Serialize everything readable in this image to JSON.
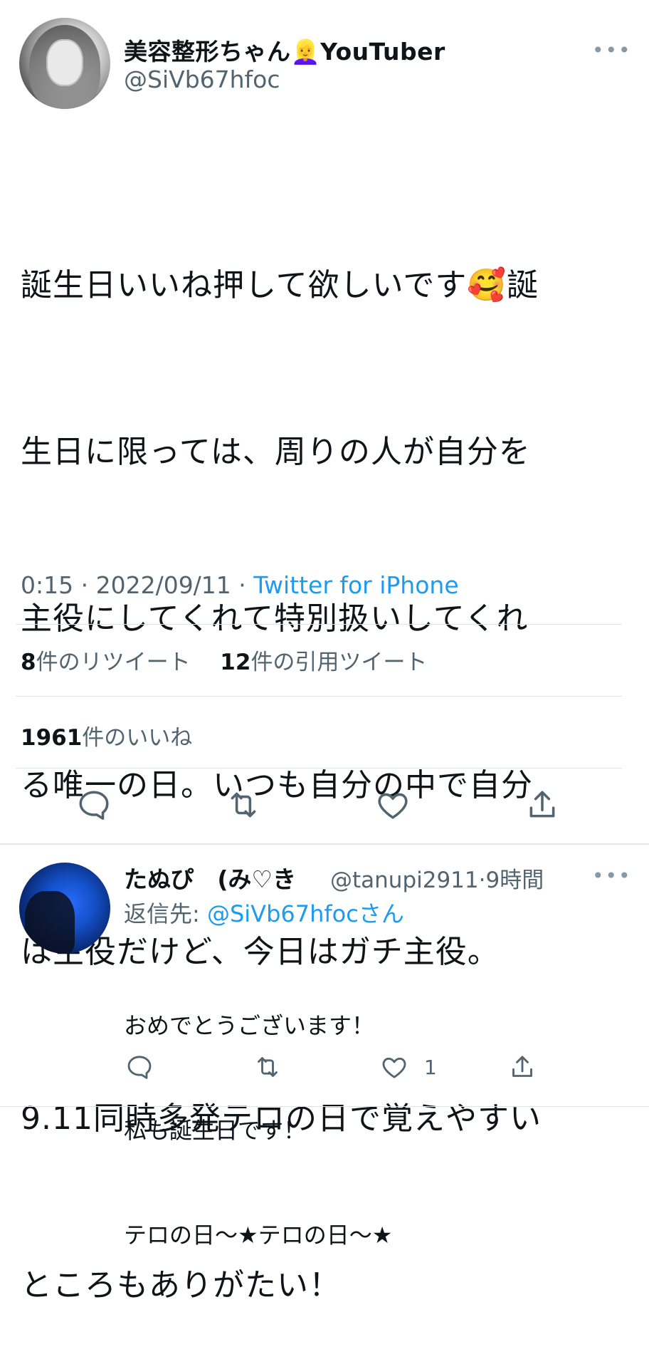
{
  "tweet": {
    "display_name": "美容整形ちゃん👱‍♀️YouTuber",
    "handle": "@SiVb67hfoc",
    "text_lines": [
      "誕生日いいね押して欲しいです🥰誕",
      "生日に限っては、周りの人が自分を",
      "主役にしてくれて特別扱いしてくれ",
      "る唯一の日。いつも自分の中で自分",
      "は主役だけど、今日はガチ主役。",
      "9.11同時多発テロの日で覚えやすい",
      "ところもありがたい！"
    ],
    "time": "0:15",
    "date": "2022/09/11",
    "source": "Twitter for iPhone",
    "retweets_count": "8",
    "retweets_label": "件のリツイート",
    "quotes_count": "12",
    "quotes_label": "件の引用ツイート",
    "likes_count": "1961",
    "likes_label": "件のいいね"
  },
  "reply": {
    "display_name": "たぬぴ　(み♡き",
    "handle": "@tanupi2911",
    "time": "9時間",
    "reply_to_prefix": "返信先: ",
    "reply_to_handle": "@SiVb67hfoc",
    "reply_to_suffix": "さん",
    "text_lines": [
      "おめでとうございます！",
      "私も誕生日です！",
      "テロの日〜★テロの日〜★"
    ],
    "like_count": "1"
  },
  "icons": {
    "reply": "comment-bubble-icon",
    "retweet": "retweet-icon",
    "like": "heart-icon",
    "share": "share-icon",
    "more": "more-dots-icon"
  },
  "colors": {
    "link": "#1d9bf0",
    "secondary_text": "#536471",
    "icon": "#536471"
  }
}
